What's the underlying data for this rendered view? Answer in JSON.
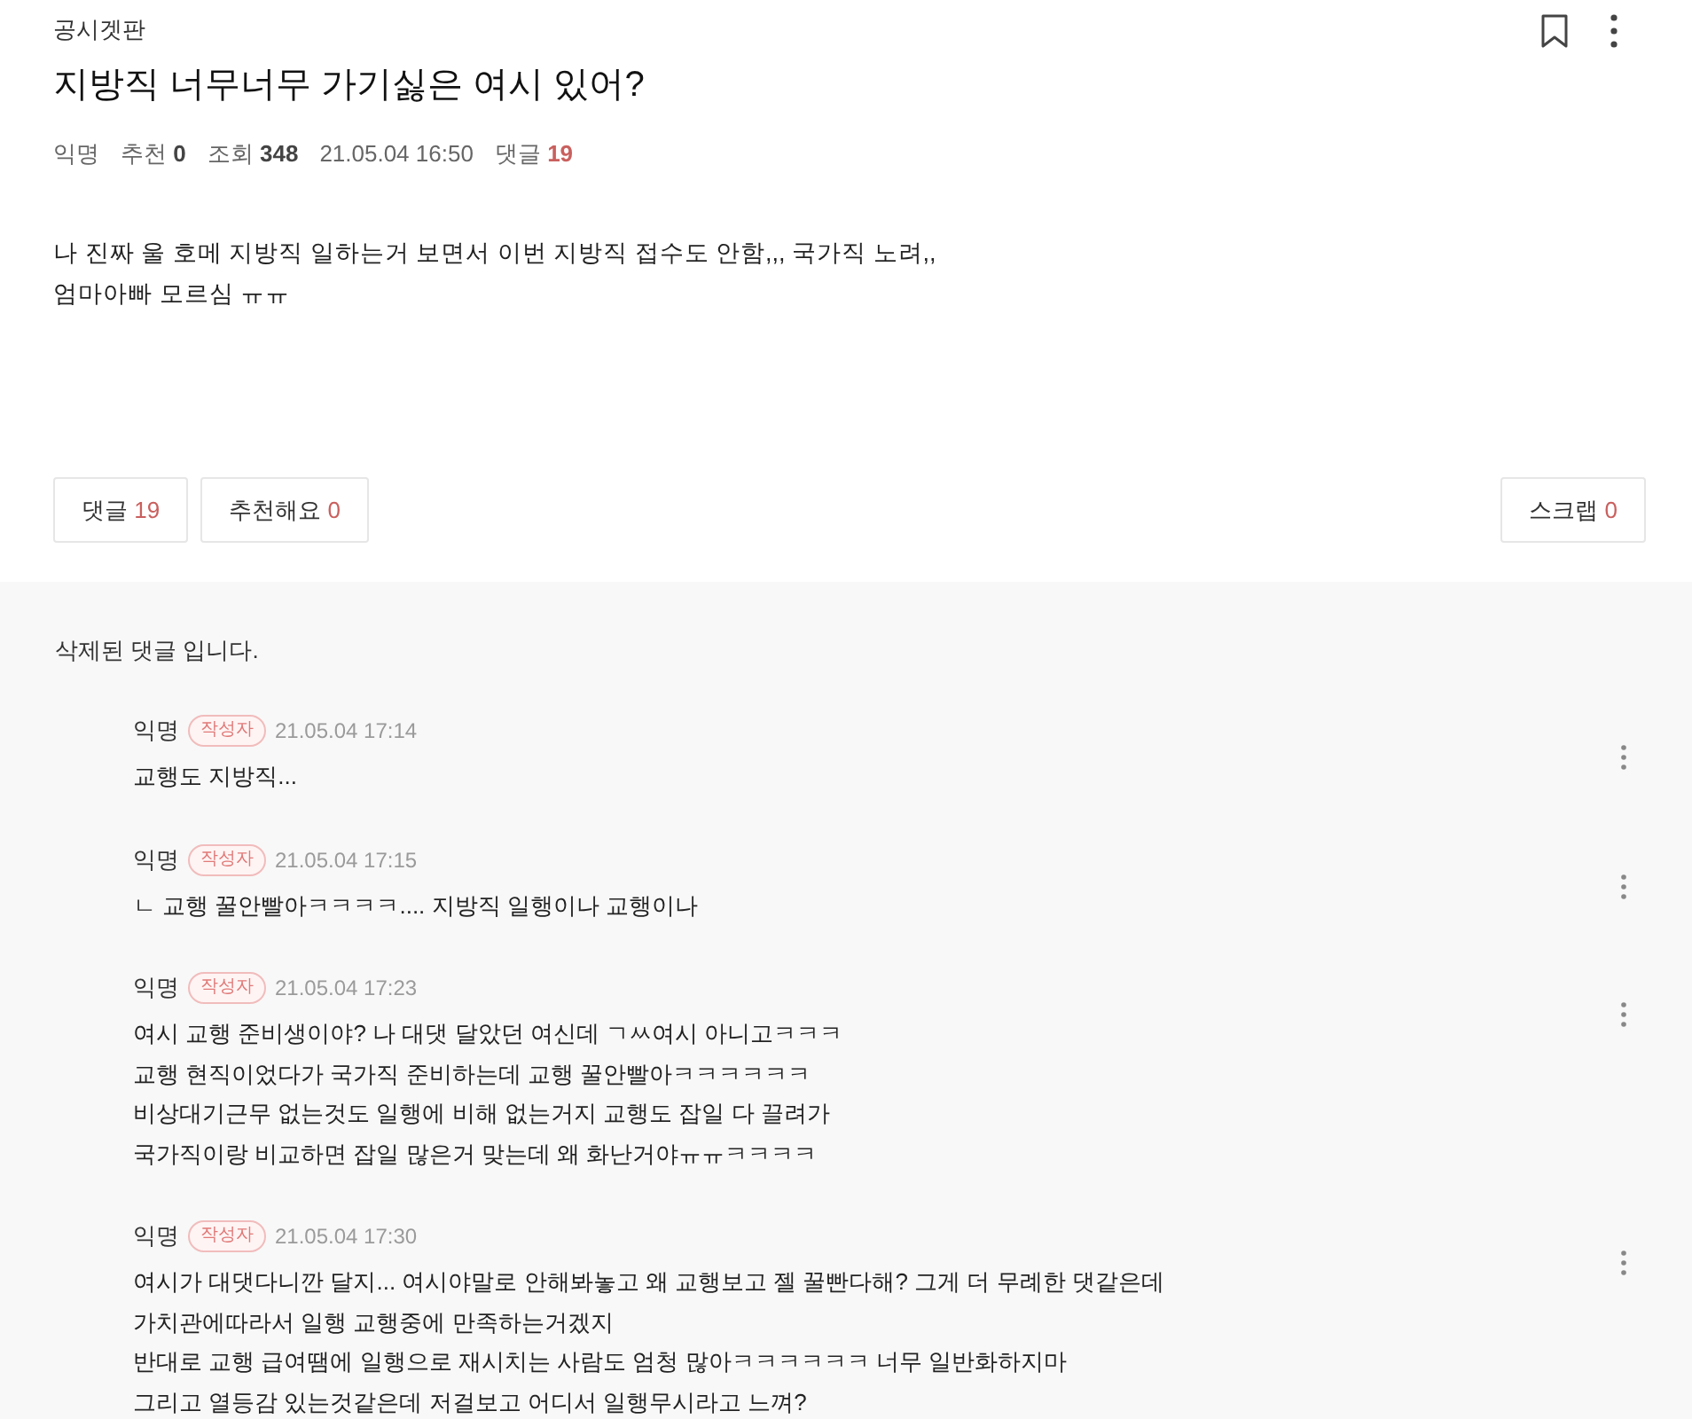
{
  "post": {
    "board": "공시겟판",
    "title": "지방직 너무너무 가기싫은 여시 있어?",
    "meta": [
      {
        "kind": "author",
        "text": "익명"
      },
      {
        "kind": "stat",
        "label": "추천",
        "value": "0"
      },
      {
        "kind": "stat",
        "label": "조회",
        "value": "348"
      },
      {
        "kind": "date",
        "text": "21.05.04 16:50"
      },
      {
        "kind": "comments",
        "label": "댓글",
        "value": "19"
      }
    ],
    "body": "나 진짜 울 호메 지방직 일하는거 보면서 이번 지방직 접수도 안함,,, 국가직 노려,,\n엄마아빠 모르심 ㅠㅠ"
  },
  "actions": {
    "left": [
      {
        "label": "댓글",
        "count": "19"
      },
      {
        "label": "추천해요",
        "count": "0"
      }
    ],
    "right": [
      {
        "label": "스크랩",
        "count": "0"
      }
    ]
  },
  "comments": [
    {
      "kind": "deleted",
      "text": "삭제된 댓글 입니다.",
      "children": [
        {
          "author": "익명",
          "badge": "작성자",
          "time": "21.05.04 17:14",
          "text": "교행도 지방직..."
        },
        {
          "author": "익명",
          "badge": "작성자",
          "time": "21.05.04 17:15",
          "text": "ㄴ 교행 꿀안빨아ㅋㅋㅋㅋ.... 지방직 일행이나 교행이나"
        },
        {
          "author": "익명",
          "badge": "작성자",
          "time": "21.05.04 17:23",
          "text": "여시 교행 준비생이야? 나 대댓 달았던 여신데 ㄱㅆ여시 아니고ㅋㅋㅋ\n교행 현직이었다가 국가직 준비하는데 교행 꿀안빨아ㅋㅋㅋㅋㅋㅋ\n비상대기근무 없는것도 일행에 비해 없는거지 교행도 잡일 다 끌려가\n국가직이랑 비교하면 잡일 많은거 맞는데 왜 화난거야ㅠㅠㅋㅋㅋㅋ"
        },
        {
          "author": "익명",
          "badge": "작성자",
          "time": "21.05.04 17:30",
          "text": "여시가 대댓다니깐 달지... 여시야말로 안해봐놓고 왜 교행보고 젤 꿀빤다해? 그게 더 무례한 댓같은데\n가치관에따라서 일행 교행중에 만족하는거겠지\n반대로 교행 급여땜에 일행으로 재시치는 사람도 엄청 많아ㅋㅋㅋㅋㅋㅋ 너무 일반화하지마\n그리고 열등감 있는것같은데 저걸보고 어디서 일행무시라고 느껴?"
        }
      ]
    }
  ]
}
